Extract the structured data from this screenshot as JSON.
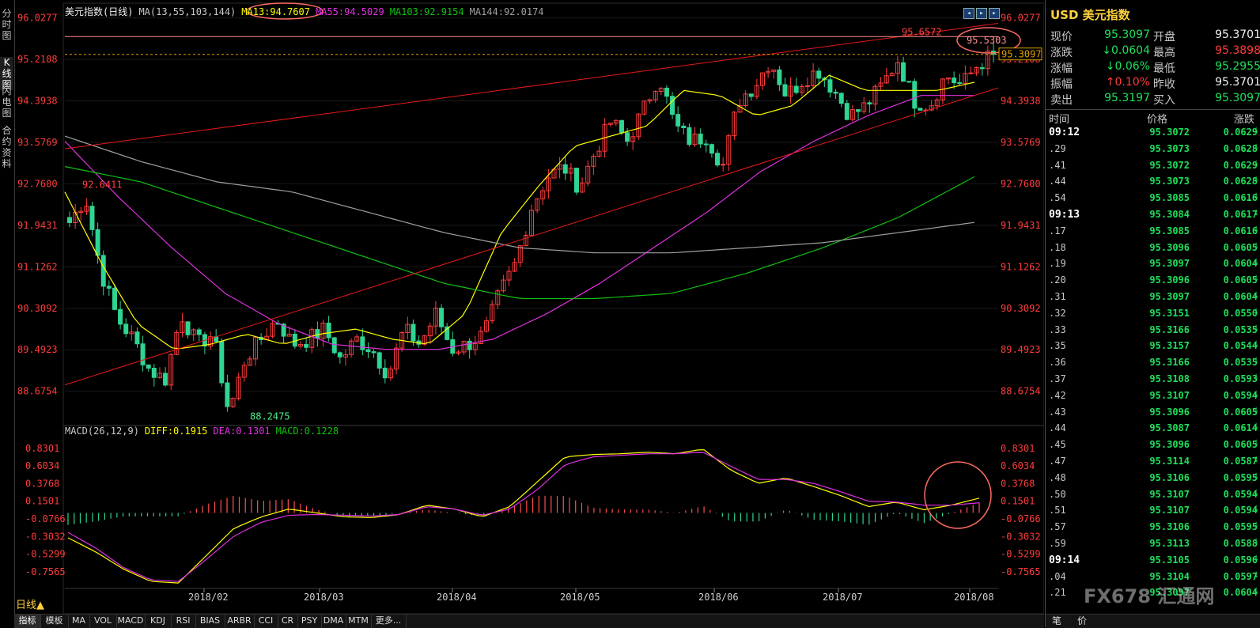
{
  "left_tabs": [
    "分\n时\n图",
    "K\n线\n图",
    "闪\n电\n图",
    "合\n约\n资\n料"
  ],
  "main_header": {
    "name": "美元指数(日线)",
    "ma_label": "MA(13,55,103,144)",
    "ma13": "MA13:94.7607",
    "ma55": "MA55:94.5029",
    "ma103": "MA103:92.9154",
    "ma144": "MA144:92.0174"
  },
  "macd_header": {
    "label": "MACD(26,12,9)",
    "diff": "DIFF:0.1915",
    "dea": "DEA:0.1301",
    "macd": "MACD:0.1228"
  },
  "period_label": "日线▲",
  "bottom_tabs": [
    "指标",
    "模板",
    "MA",
    "VOL",
    "MACD",
    "KDJ",
    "RSI",
    "BIAS",
    "ARBR",
    "CCI",
    "CR",
    "PSY",
    "DMA",
    "MTM",
    "更多..."
  ],
  "colors": {
    "up": "#ff3c3c",
    "down": "#2fd592",
    "ma13": "#ffff00",
    "ma55": "#e030e0",
    "ma103": "#10c010",
    "ma144": "#a0a0a0",
    "trend": "#e81818",
    "annotation": "#ff6b60"
  },
  "chart_data": [
    {
      "type": "candlestick",
      "title": "美元指数(日线)",
      "y_ticks": [
        96.0277,
        95.2108,
        94.3938,
        93.5769,
        92.76,
        91.9431,
        91.1262,
        90.3092,
        89.4923,
        88.6754
      ],
      "ylim": [
        88.0,
        96.1
      ],
      "x_ticks": [
        "2018/02",
        "2018/03",
        "2018/04",
        "2018/05",
        "2018/06",
        "2018/07",
        "2018/08"
      ],
      "annotations": [
        {
          "text": "92.6411",
          "kind": "high"
        },
        {
          "text": "88.2475",
          "kind": "low"
        },
        {
          "text": "95.6572",
          "kind": "high"
        },
        {
          "text": "95.5303",
          "kind": "circled"
        },
        {
          "text": "95.3097",
          "kind": "last-price"
        }
      ],
      "waypoints": [
        92.0,
        92.5,
        91.0,
        90.1,
        89.7,
        89.1,
        88.9,
        90.2,
        89.6,
        89.8,
        88.25,
        89.3,
        89.7,
        90.1,
        89.6,
        89.7,
        89.9,
        89.3,
        89.7,
        89.5,
        89.0,
        89.9,
        89.6,
        90.2,
        89.5,
        89.6,
        89.8,
        90.6,
        91.2,
        92.3,
        92.9,
        93.1,
        92.7,
        93.4,
        94.0,
        93.6,
        94.2,
        94.9,
        93.9,
        93.6,
        93.7,
        93.1,
        94.4,
        94.7,
        95.2,
        94.5,
        94.8,
        95.0,
        94.6,
        94.1,
        94.3,
        94.7,
        95.2,
        94.4,
        94.3,
        94.9,
        94.7,
        95.1,
        95.31
      ],
      "series": [
        {
          "name": "MA13",
          "waypoints": [
            92.6,
            91.2,
            90.0,
            89.5,
            89.6,
            89.8,
            89.6,
            89.8,
            89.9,
            89.7,
            89.6,
            90.2,
            91.8,
            92.7,
            93.5,
            93.7,
            93.9,
            94.6,
            94.5,
            94.1,
            94.3,
            94.9,
            94.6,
            94.6,
            94.6,
            94.76
          ]
        },
        {
          "name": "MA55",
          "waypoints": [
            93.6,
            92.5,
            91.5,
            90.6,
            90.0,
            89.6,
            89.5,
            89.5,
            89.7,
            90.2,
            90.8,
            91.5,
            92.2,
            93.0,
            93.6,
            94.1,
            94.5,
            94.5
          ]
        },
        {
          "name": "MA103",
          "waypoints": [
            93.1,
            92.8,
            92.3,
            91.8,
            91.3,
            90.8,
            90.5,
            90.5,
            90.6,
            91.0,
            91.5,
            92.1,
            92.9
          ]
        },
        {
          "name": "MA144",
          "waypoints": [
            93.7,
            93.2,
            92.8,
            92.6,
            92.2,
            91.8,
            91.5,
            91.4,
            91.4,
            91.5,
            91.6,
            91.8,
            92.0
          ]
        }
      ]
    },
    {
      "type": "macd",
      "title": "MACD(26,12,9)",
      "y_ticks": [
        0.8301,
        0.6034,
        0.3768,
        0.1501,
        -0.0766,
        -0.3032,
        -0.5299,
        -0.7565
      ],
      "ylim": [
        -0.95,
        0.95
      ],
      "series": [
        {
          "name": "DIFF",
          "waypoints": [
            -0.32,
            -0.5,
            -0.72,
            -0.88,
            -0.9,
            -0.55,
            -0.2,
            -0.05,
            0.05,
            0.0,
            -0.05,
            -0.06,
            -0.02,
            0.1,
            0.05,
            -0.05,
            0.08,
            0.4,
            0.72,
            0.75,
            0.76,
            0.78,
            0.76,
            0.82,
            0.55,
            0.38,
            0.45,
            0.34,
            0.22,
            0.08,
            0.14,
            0.04,
            0.1,
            0.19
          ]
        },
        {
          "name": "DEA",
          "waypoints": [
            -0.25,
            -0.45,
            -0.7,
            -0.86,
            -0.88,
            -0.6,
            -0.3,
            -0.12,
            -0.03,
            -0.02,
            -0.03,
            -0.04,
            -0.02,
            0.08,
            0.05,
            -0.03,
            0.05,
            0.3,
            0.62,
            0.72,
            0.74,
            0.76,
            0.76,
            0.78,
            0.6,
            0.43,
            0.43,
            0.38,
            0.27,
            0.15,
            0.14,
            0.1,
            0.1,
            0.13
          ]
        }
      ]
    }
  ],
  "quote_panel": {
    "title": "USD 美元指数",
    "rows": [
      {
        "l1": "现价",
        "v1": "95.3097",
        "c1": "green",
        "l2": "开盘",
        "v2": "95.3701",
        "c2": "white"
      },
      {
        "l1": "涨跌",
        "v1": "↓0.0604",
        "c1": "green",
        "l2": "最高",
        "v2": "95.3898",
        "c2": "red"
      },
      {
        "l1": "涨幅",
        "v1": "↓0.06%",
        "c1": "green",
        "l2": "最低",
        "v2": "95.2955",
        "c2": "green"
      },
      {
        "l1": "振幅",
        "v1": "↑0.10%",
        "c1": "red",
        "l2": "昨收",
        "v2": "95.3701",
        "c2": "white"
      },
      {
        "l1": "卖出",
        "v1": "95.3197",
        "c1": "green",
        "l2": "买入",
        "v2": "95.3097",
        "c2": "green"
      }
    ],
    "table_headers": [
      "时间",
      "价格",
      "涨跌"
    ],
    "ticks": [
      {
        "time": "09:12",
        "full": true,
        "price": "95.3072",
        "chg": "0.0629"
      },
      {
        "time": ".29",
        "full": false,
        "price": "95.3073",
        "chg": "0.0628"
      },
      {
        "time": ".41",
        "full": false,
        "price": "95.3072",
        "chg": "0.0629"
      },
      {
        "time": ".44",
        "full": false,
        "price": "95.3073",
        "chg": "0.0628"
      },
      {
        "time": ".54",
        "full": false,
        "price": "95.3085",
        "chg": "0.0616"
      },
      {
        "time": "09:13",
        "full": true,
        "price": "95.3084",
        "chg": "0.0617"
      },
      {
        "time": ".17",
        "full": false,
        "price": "95.3085",
        "chg": "0.0616"
      },
      {
        "time": ".18",
        "full": false,
        "price": "95.3096",
        "chg": "0.0605"
      },
      {
        "time": ".19",
        "full": false,
        "price": "95.3097",
        "chg": "0.0604"
      },
      {
        "time": ".20",
        "full": false,
        "price": "95.3096",
        "chg": "0.0605"
      },
      {
        "time": ".31",
        "full": false,
        "price": "95.3097",
        "chg": "0.0604"
      },
      {
        "time": ".32",
        "full": false,
        "price": "95.3151",
        "chg": "0.0550"
      },
      {
        "time": ".33",
        "full": false,
        "price": "95.3166",
        "chg": "0.0535"
      },
      {
        "time": ".35",
        "full": false,
        "price": "95.3157",
        "chg": "0.0544"
      },
      {
        "time": ".36",
        "full": false,
        "price": "95.3166",
        "chg": "0.0535"
      },
      {
        "time": ".37",
        "full": false,
        "price": "95.3108",
        "chg": "0.0593"
      },
      {
        "time": ".42",
        "full": false,
        "price": "95.3107",
        "chg": "0.0594"
      },
      {
        "time": ".43",
        "full": false,
        "price": "95.3096",
        "chg": "0.0605"
      },
      {
        "time": ".44",
        "full": false,
        "price": "95.3087",
        "chg": "0.0614"
      },
      {
        "time": ".45",
        "full": false,
        "price": "95.3096",
        "chg": "0.0605"
      },
      {
        "time": ".47",
        "full": false,
        "price": "95.3114",
        "chg": "0.0587"
      },
      {
        "time": ".48",
        "full": false,
        "price": "95.3106",
        "chg": "0.0595"
      },
      {
        "time": ".50",
        "full": false,
        "price": "95.3107",
        "chg": "0.0594"
      },
      {
        "time": ".51",
        "full": false,
        "price": "95.3107",
        "chg": "0.0594"
      },
      {
        "time": ".57",
        "full": false,
        "price": "95.3106",
        "chg": "0.0595"
      },
      {
        "time": ".59",
        "full": false,
        "price": "95.3113",
        "chg": "0.0588"
      },
      {
        "time": "09:14",
        "full": true,
        "price": "95.3105",
        "chg": "0.0596"
      },
      {
        "time": ".04",
        "full": false,
        "price": "95.3104",
        "chg": "0.0597"
      },
      {
        "time": ".21",
        "full": false,
        "price": "95.3097",
        "chg": "0.0604"
      }
    ],
    "bottom_tabs": [
      "笔",
      "价"
    ],
    "watermark": "FX678 汇通网"
  }
}
